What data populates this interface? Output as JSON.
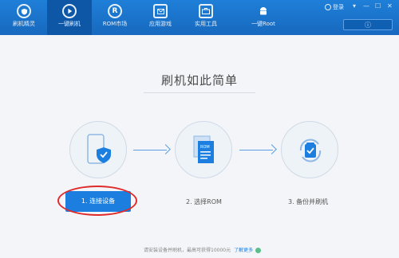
{
  "nav": {
    "tabs": [
      {
        "label": "刷机精灵",
        "icon": "shield-icon"
      },
      {
        "label": "一键刷机",
        "icon": "play-icon"
      },
      {
        "label": "ROM市场",
        "icon": "r-icon"
      },
      {
        "label": "应用游戏",
        "icon": "mail-icon"
      },
      {
        "label": "实用工具",
        "icon": "toolbox-icon"
      },
      {
        "label": "一键Root",
        "icon": "android-icon"
      }
    ],
    "login_label": "登录",
    "window_controls": [
      "▾",
      "—",
      "☐",
      "✕"
    ]
  },
  "main": {
    "headline": "刷机如此简单",
    "steps": [
      {
        "label": "1. 连接设备",
        "icon": "phone-shield-icon"
      },
      {
        "label": "2. 选择ROM",
        "icon": "rom-file-icon"
      },
      {
        "label": "3. 备份并刷机",
        "icon": "backup-refresh-icon"
      }
    ]
  },
  "footer": {
    "text": "请安装设备并刷机，最高可获得10000元",
    "link": "了解更多"
  },
  "colors": {
    "header_blue": "#1769be",
    "accent_blue": "#1c7fe0",
    "annotation_red": "#e02a2a"
  }
}
